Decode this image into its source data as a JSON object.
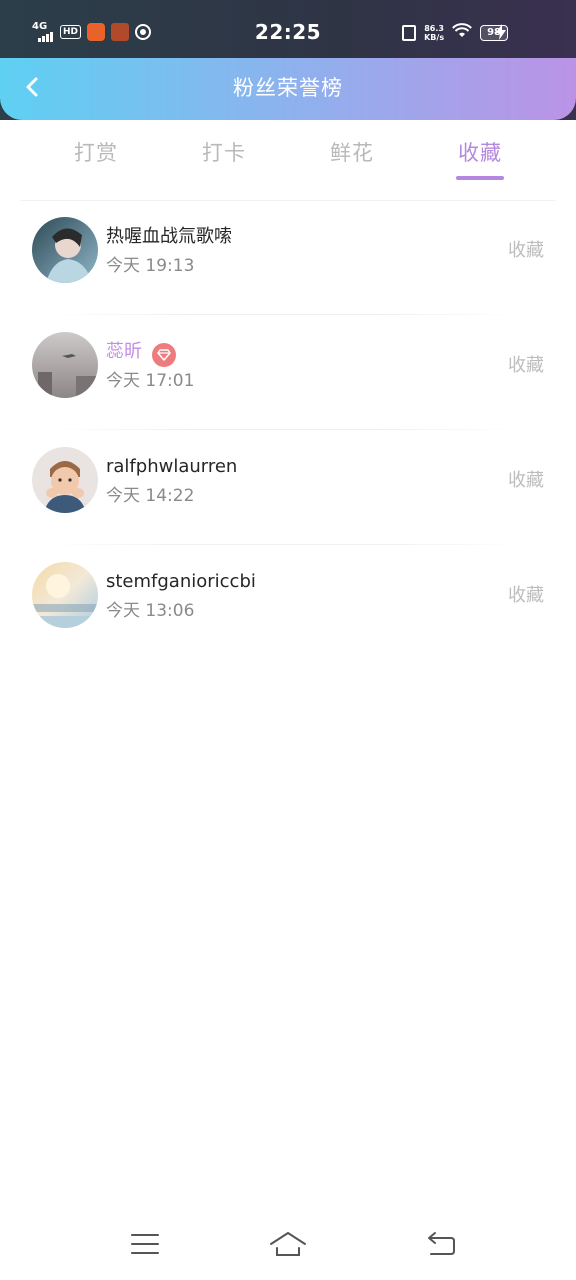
{
  "status_bar": {
    "network": "4G",
    "hd": "HD",
    "time": "22:25",
    "speed_value": "86.3",
    "speed_unit": "KB/s",
    "battery": "98"
  },
  "header": {
    "title": "粉丝荣誉榜",
    "back_icon": "chevron-left-icon"
  },
  "tabs": [
    {
      "label": "打赏",
      "active": false
    },
    {
      "label": "打卡",
      "active": false
    },
    {
      "label": "鲜花",
      "active": false
    },
    {
      "label": "收藏",
      "active": true
    }
  ],
  "list": [
    {
      "name": "热喔血战氚歌嗦",
      "time": "今天 19:13",
      "action": "收藏",
      "vip": false
    },
    {
      "name": "蕊昕",
      "time": "今天 17:01",
      "action": "收藏",
      "vip": true,
      "badge_icon": "diamond-icon"
    },
    {
      "name": "ralfphwlaurren",
      "time": "今天 14:22",
      "action": "收藏",
      "vip": false
    },
    {
      "name": "stemfganioriccbi",
      "time": "今天 13:06",
      "action": "收藏",
      "vip": false
    }
  ],
  "colors": {
    "accent": "#b488df",
    "header_gradient_start": "#5ed0f2",
    "header_gradient_end": "#bb93e6",
    "badge": "#ee7c7f"
  },
  "nav": [
    "menu-icon",
    "home-icon",
    "back-icon"
  ]
}
